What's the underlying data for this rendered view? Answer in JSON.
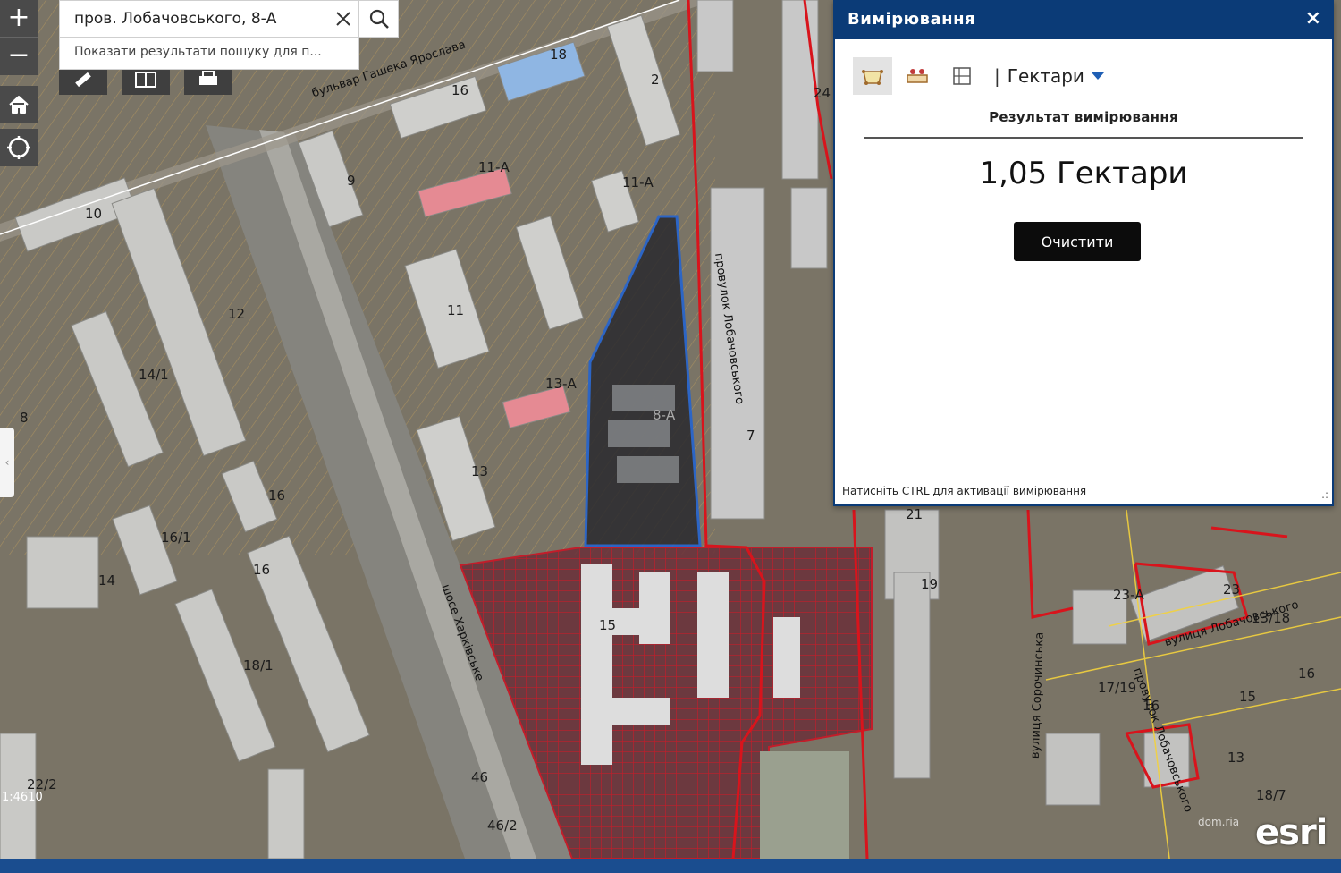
{
  "search": {
    "value": "пров. Лобачовського, 8-А",
    "suggestion": "Показати результати пошуку для п..."
  },
  "zoom": {
    "in_symbol": "+",
    "out_symbol": "−"
  },
  "panel": {
    "title": "Вимірювання",
    "close_symbol": "×",
    "unit_separator": "|",
    "unit": "Гектари",
    "result_label": "Результат вимірювання",
    "result_value": "1,05 Гектари",
    "clear_label": "Очистити",
    "hint": "Натисніть CTRL для активації вимірювання",
    "resize_symbol": ".:"
  },
  "map": {
    "building_labels": [
      "18",
      "16",
      "2",
      "11-А",
      "11-А",
      "10",
      "9",
      "11",
      "14/1",
      "13-А",
      "13",
      "12",
      "8",
      "16",
      "16/1",
      "16",
      "14",
      "15",
      "7",
      "21",
      "19",
      "23-А",
      "23",
      "13/18",
      "16",
      "15",
      "17/19",
      "16",
      "13",
      "18/1",
      "46",
      "46/2",
      "22/2",
      "24",
      "8-А",
      "18/7"
    ],
    "street_labels": [
      "бульвар Гашека Ярослава",
      "шосе Харківське",
      "провулок Лобачовського",
      "вулиця Сорочинська",
      "вулиця Лобачовського",
      "провулок Лобачовського"
    ],
    "scale": "1:4610",
    "watermark": "dom.ria",
    "logo": "esri"
  },
  "colors": {
    "panel_header": "#0b3b77",
    "measure_outline": "#1f63d6",
    "parcel_red": "#d8141c",
    "clear_button": "#0c0c0c"
  },
  "icons": {
    "zoom_in": "plus-icon",
    "zoom_out": "minus-icon",
    "home": "home-icon",
    "locate": "locate-icon",
    "search_clear": "close-icon",
    "search_go": "search-icon",
    "measure_area": "area-measure-icon",
    "measure_distance": "distance-measure-icon",
    "measure_location": "location-measure-icon",
    "unit_dropdown": "caret-down-icon"
  }
}
